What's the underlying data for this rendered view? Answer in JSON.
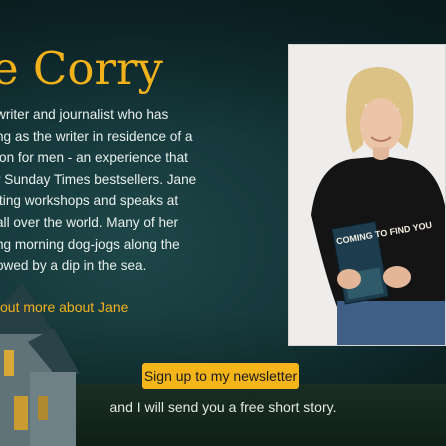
{
  "author": {
    "heading": "e Corry"
  },
  "bio": {
    "lines": [
      " writer and journalist who has",
      "ng as the writer in residence of a",
      "ion for men - an experience that",
      "r Sunday Times bestsellers. Jane",
      "iting workshops and speaks at",
      "all over the world. Many of her",
      "ng morning dog-jogs along the",
      "owed by a dip in the sea."
    ],
    "link_label": "out more about Jane"
  },
  "photo": {
    "book_title": "COMING TO FIND YOU"
  },
  "newsletter": {
    "button_label": "Sign up to my newsletter",
    "tagline": "and I will send you a free short story."
  },
  "colors": {
    "accent": "#f2b21c",
    "background": "#15383b",
    "text": "#e9efec"
  }
}
